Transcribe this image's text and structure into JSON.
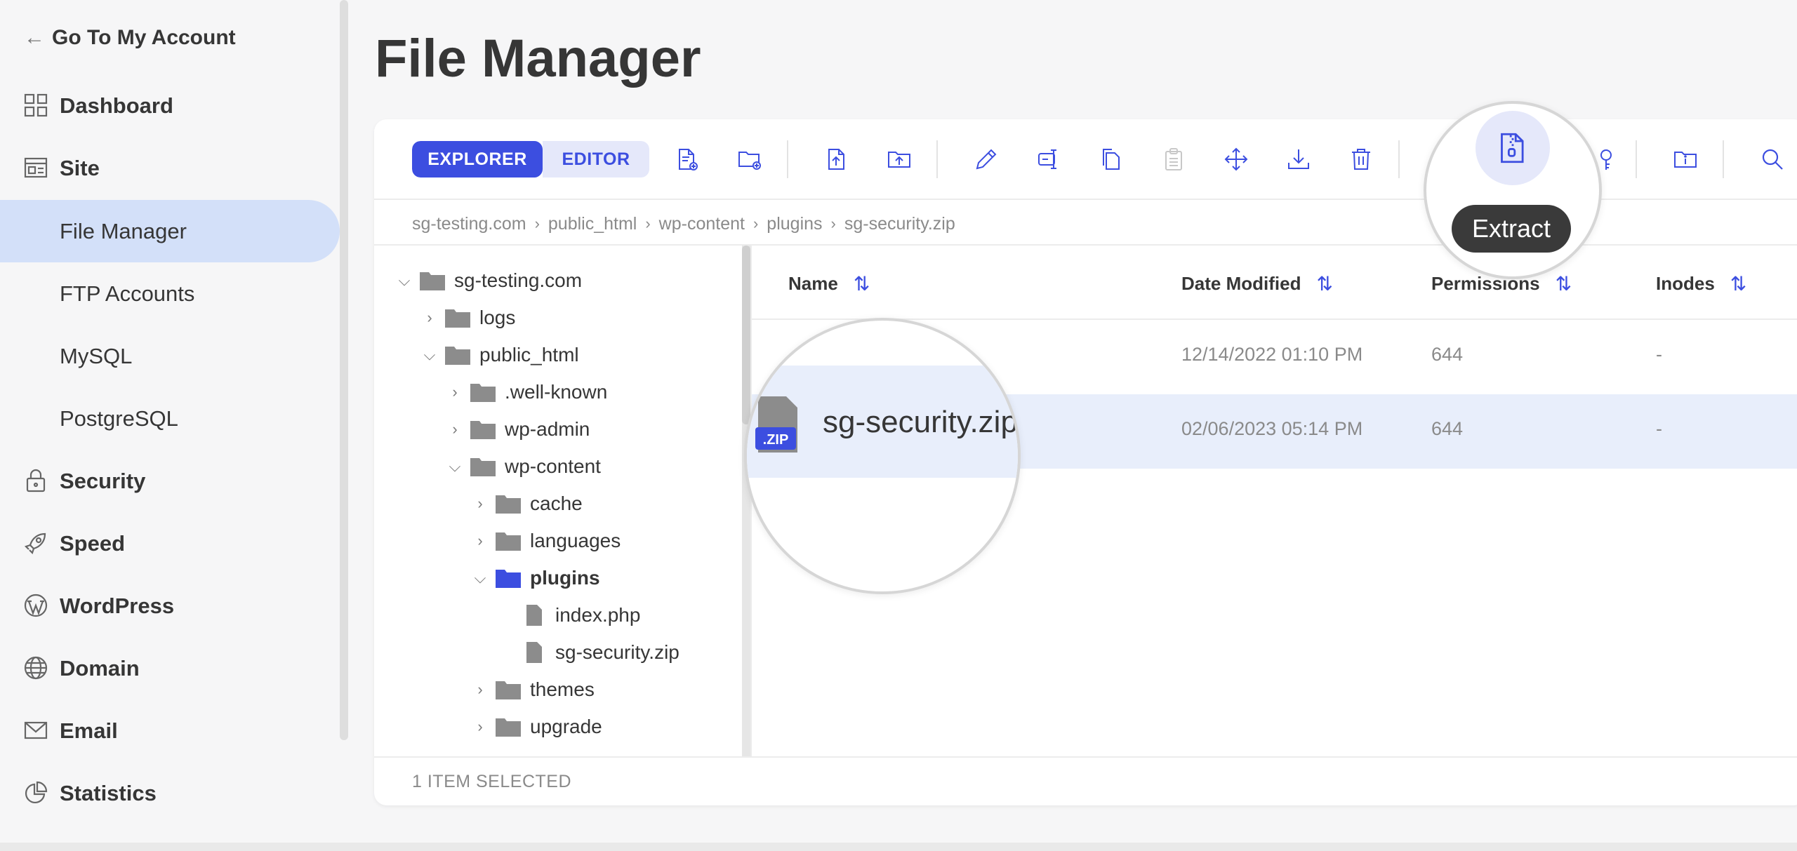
{
  "sidebar": {
    "back_label": "Go To My Account",
    "items": [
      {
        "label": "Dashboard",
        "icon": "dashboard-grid-icon",
        "type": "main"
      },
      {
        "label": "Site",
        "icon": "site-layout-icon",
        "type": "main"
      },
      {
        "label": "File Manager",
        "type": "sub",
        "active": true
      },
      {
        "label": "FTP Accounts",
        "type": "sub"
      },
      {
        "label": "MySQL",
        "type": "sub"
      },
      {
        "label": "PostgreSQL",
        "type": "sub"
      },
      {
        "label": "Security",
        "icon": "lock-icon",
        "type": "main"
      },
      {
        "label": "Speed",
        "icon": "rocket-icon",
        "type": "main"
      },
      {
        "label": "WordPress",
        "icon": "wordpress-icon",
        "type": "main"
      },
      {
        "label": "Domain",
        "icon": "globe-icon",
        "type": "main"
      },
      {
        "label": "Email",
        "icon": "envelope-icon",
        "type": "main"
      },
      {
        "label": "Statistics",
        "icon": "pie-chart-icon",
        "type": "main"
      }
    ]
  },
  "page": {
    "title": "File Manager"
  },
  "toolbar": {
    "explorer_label": "EXPLORER",
    "editor_label": "EDITOR",
    "tooltip": "Extract"
  },
  "breadcrumb": [
    "sg-testing.com",
    "public_html",
    "wp-content",
    "plugins",
    "sg-security.zip"
  ],
  "tree": [
    {
      "label": "sg-testing.com",
      "type": "folder",
      "expanded": true,
      "depth": 0
    },
    {
      "label": "logs",
      "type": "folder",
      "expanded": false,
      "depth": 1
    },
    {
      "label": "public_html",
      "type": "folder",
      "expanded": true,
      "depth": 1
    },
    {
      "label": ".well-known",
      "type": "folder",
      "expanded": false,
      "depth": 2
    },
    {
      "label": "wp-admin",
      "type": "folder",
      "expanded": false,
      "depth": 2
    },
    {
      "label": "wp-content",
      "type": "folder",
      "expanded": true,
      "depth": 2
    },
    {
      "label": "cache",
      "type": "folder",
      "expanded": false,
      "depth": 3
    },
    {
      "label": "languages",
      "type": "folder",
      "expanded": false,
      "depth": 3
    },
    {
      "label": "plugins",
      "type": "folder",
      "expanded": true,
      "depth": 3,
      "active": true
    },
    {
      "label": "index.php",
      "type": "file",
      "depth": 4
    },
    {
      "label": "sg-security.zip",
      "type": "file",
      "depth": 4
    },
    {
      "label": "themes",
      "type": "folder",
      "expanded": false,
      "depth": 3
    },
    {
      "label": "upgrade",
      "type": "folder",
      "expanded": false,
      "depth": 3
    }
  ],
  "table": {
    "columns": [
      "Name",
      "Date Modified",
      "Permissions",
      "Inodes"
    ],
    "rows": [
      {
        "name": "",
        "date": "12/14/2022 01:10 PM",
        "permissions": "644",
        "inodes": "-"
      },
      {
        "name": "sg-security.zip",
        "date": "02/06/2023 05:14 PM",
        "permissions": "644",
        "inodes": "-",
        "selected": true
      }
    ]
  },
  "zip_badge": ".ZIP",
  "status": "1 ITEM SELECTED",
  "colors": {
    "accent": "#3c4ee0",
    "active_nav": "#d3e0f9",
    "selected_row": "#e8eefb"
  }
}
